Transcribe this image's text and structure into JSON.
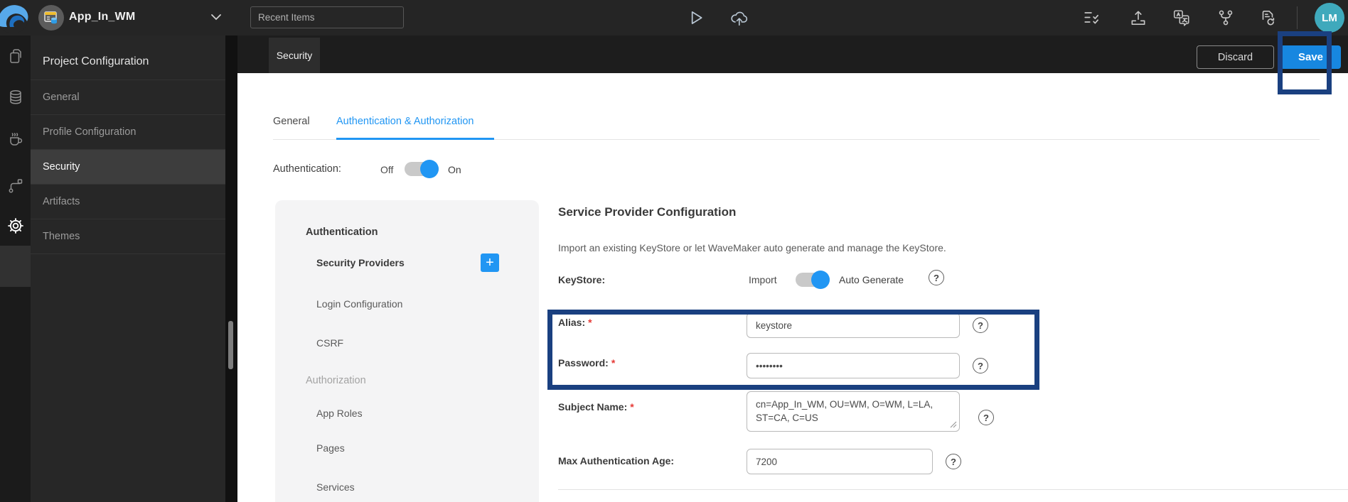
{
  "topbar": {
    "app_name": "App_In_WM",
    "recent_items_placeholder": "Recent Items",
    "avatar_initials": "LM",
    "left_icons": [
      "wavemaker-logo",
      "app-icon",
      "chevron-down-icon"
    ],
    "center_icons": [
      "run-icon",
      "deploy-icon"
    ],
    "right_icons": [
      "checklist-icon",
      "export-icon",
      "translate-icon",
      "branch-icon",
      "file-sync-icon"
    ]
  },
  "left_rail": {
    "icons": [
      "pages-icon",
      "database-icon",
      "java-services-icon",
      "apis-icon",
      "settings-icon"
    ],
    "active_icon": "settings-icon"
  },
  "sidebar": {
    "title": "Project Configuration",
    "items": [
      {
        "label": "General",
        "active": false
      },
      {
        "label": "Profile Configuration",
        "active": false
      },
      {
        "label": "Security",
        "active": true
      },
      {
        "label": "Artifacts",
        "active": false
      },
      {
        "label": "Themes",
        "active": false
      }
    ]
  },
  "page_header": {
    "active_page_tab": "Security",
    "discard_label": "Discard",
    "save_label": "Save"
  },
  "content_tabs": {
    "tabs": [
      {
        "label": "General",
        "active": false
      },
      {
        "label": "Authentication & Authorization",
        "active": true
      }
    ]
  },
  "authentication_row": {
    "label": "Authentication:",
    "off_label": "Off",
    "on_label": "On",
    "state": "On"
  },
  "security_nav": {
    "add_button_glyph": "+",
    "sections": [
      {
        "title": "Authentication",
        "items": [
          {
            "label": "Security Providers",
            "active": true,
            "has_add_button": true
          },
          {
            "label": "Login Configuration",
            "active": false
          },
          {
            "label": "CSRF",
            "active": false
          }
        ]
      },
      {
        "title": "Authorization",
        "items": [
          {
            "label": "App Roles",
            "active": false
          },
          {
            "label": "Pages",
            "active": false
          },
          {
            "label": "Services",
            "active": false
          }
        ]
      }
    ]
  },
  "service_provider": {
    "title": "Service Provider Configuration",
    "description": "Import an existing KeyStore or let WaveMaker auto generate and manage the KeyStore.",
    "keystore_row": {
      "label": "KeyStore:",
      "option_left": "Import",
      "option_right": "Auto Generate",
      "selected": "Auto Generate"
    },
    "required_marker": "*",
    "help_glyph": "?",
    "fields": {
      "alias": {
        "label": "Alias:",
        "required": true,
        "value": "keystore"
      },
      "password": {
        "label": "Password:",
        "required": true,
        "value": "••••••••"
      },
      "subject_name": {
        "label": "Subject Name:",
        "required": true,
        "value": "cn=App_In_WM, OU=WM, O=WM, L=LA, ST=CA, C=US"
      },
      "max_authentication_age": {
        "label": "Max Authentication Age:",
        "required": false,
        "value": "7200"
      }
    }
  },
  "colors": {
    "accent_blue": "#2196f3",
    "save_button_blue": "#1787e0",
    "annotation_navy": "#1a4080",
    "avatar_teal": "#3fa9bc",
    "required_red": "#e53935"
  }
}
